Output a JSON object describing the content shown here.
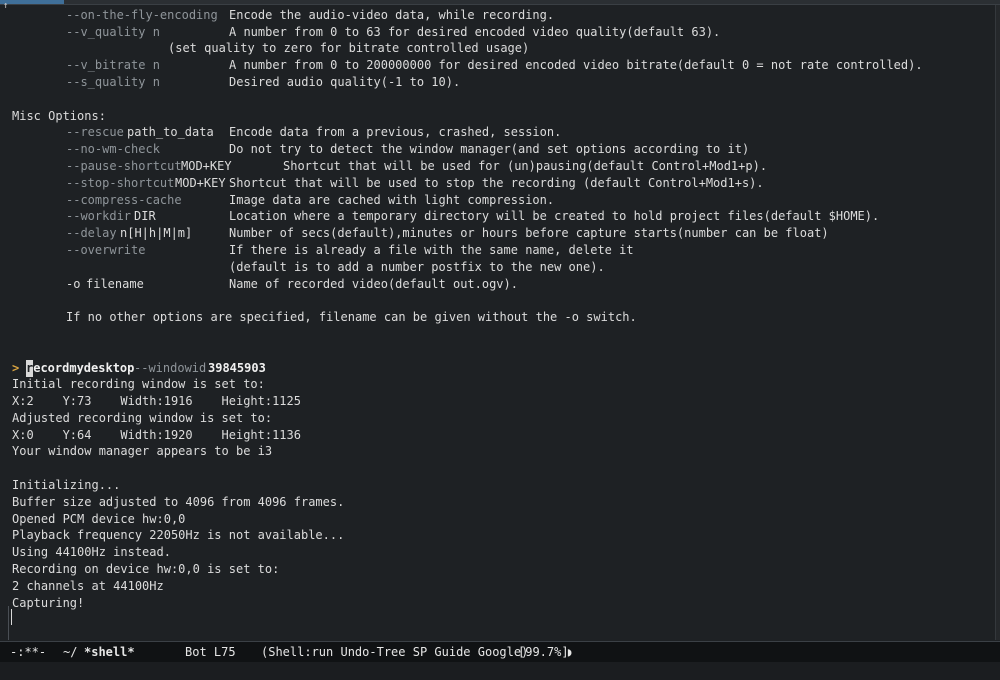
{
  "options": [
    {
      "flag": "--on-the-fly-encoding",
      "desc": "Encode the audio-video data, while recording."
    },
    {
      "flag": "--v_quality n",
      "desc": "A number from 0 to 63 for desired encoded video quality(default 63)."
    },
    {
      "flag": "",
      "desc": "(set quality to zero for bitrate controlled usage)"
    },
    {
      "flag": "--v_bitrate n",
      "desc": "A number from 0 to 200000000 for desired encoded video bitrate(default 0 = not rate controlled)."
    },
    {
      "flag": "--s_quality n",
      "desc": "Desired audio quality(-1 to 10)."
    }
  ],
  "misc_heading": "Misc Options:",
  "misc": [
    {
      "flag": "--rescue",
      "arg": "path_to_data",
      "desc": "Encode data from a previous, crashed, session."
    },
    {
      "flag": "--no-wm-check",
      "arg": "",
      "desc": "Do not try to detect the window manager(and set options according to it)"
    },
    {
      "flag": "--pause-shortcut",
      "arg": "MOD+KEY",
      "desc": "Shortcut that will be used for (un)pausing(default Control+Mod1+p)."
    },
    {
      "flag": "--stop-shortcut",
      "arg": "MOD+KEY",
      "desc": "Shortcut that will be used to stop the recording (default Control+Mod1+s)."
    },
    {
      "flag": "--compress-cache",
      "arg": "",
      "desc": "Image data are cached with light compression."
    },
    {
      "flag": "--workdir",
      "arg": "DIR",
      "desc": "Location where a temporary directory will be created to hold project files(default $HOME)."
    },
    {
      "flag": "--delay",
      "arg": "n[H|h|M|m]",
      "desc": "Number of secs(default),minutes or hours before capture starts(number can be float)"
    },
    {
      "flag": "--overwrite",
      "arg": "",
      "desc": "If there is already a file with the same name, delete it"
    },
    {
      "flag": "",
      "arg": "",
      "desc": "(default is to add a number postfix to the new one)."
    },
    {
      "flag": "-o",
      "arg": "filename",
      "desc": "Name of recorded video(default out.ogv)."
    }
  ],
  "footnote": "If no other options are specified, filename can be given without the -o switch.",
  "command": {
    "prompt": ">",
    "first_char": "r",
    "program_rest": "ecordmydesktop",
    "flag": "--windowid",
    "value": "39845903"
  },
  "output": [
    "Initial recording window is set to:",
    "X:2    Y:73    Width:1916    Height:1125",
    "Adjusted recording window is set to:",
    "X:0    Y:64    Width:1920    Height:1136",
    "Your window manager appears to be i3",
    "",
    "Initializing...",
    "Buffer size adjusted to 4096 from 4096 frames.",
    "Opened PCM device hw:0,0",
    "Playback frequency 22050Hz is not available...",
    "Using 44100Hz instead.",
    "Recording on device hw:0,0 is set to:",
    "2 channels at 44100Hz",
    "Capturing!"
  ],
  "modeline": {
    "state": "-:**-",
    "dir": "~/",
    "buffer_name": "*shell*",
    "position": "Bot L75",
    "modes": "(Shell:run Undo-Tree SP Guide Google)",
    "percent": "[99.7%]"
  },
  "icons": {
    "corner": "up-arrow-icon",
    "modeline_end": "half-circle-icon"
  },
  "colors": {
    "background": "#1e2124",
    "text": "#dcdcdc",
    "dim": "#8f959a",
    "prompt": "#d9a441",
    "modeline_bg": "#101214"
  }
}
